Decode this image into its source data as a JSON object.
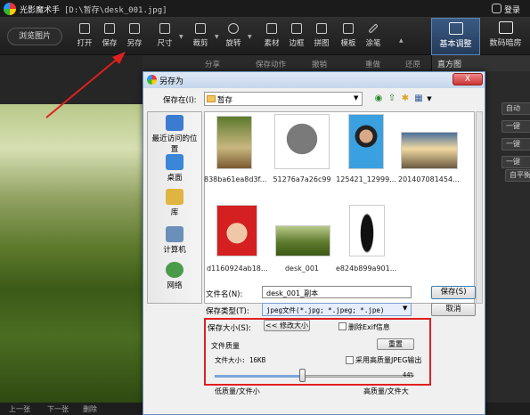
{
  "app": {
    "title": "光影魔术手",
    "path": "[D:\\暂存\\desk_001.jpg]",
    "login": "登录"
  },
  "toolbar": {
    "browse": "浏览图片",
    "tools": [
      "打开",
      "保存",
      "另存",
      "尺寸",
      "裁剪",
      "旋转",
      "素材",
      "边框",
      "拼图",
      "模板",
      "涂笔"
    ],
    "tabs": {
      "basic": "基本调整",
      "digital": "数码暗房"
    }
  },
  "subbar": {
    "share": "分享",
    "action": "保存动作",
    "undo": "撤销",
    "redo": "重做",
    "restore": "还原",
    "histogram": "直方图"
  },
  "right_buttons": [
    "自动",
    "一键",
    "一键",
    "一键",
    "自平衡"
  ],
  "bottom": [
    "上一张",
    "下一张",
    "删除"
  ],
  "dialog": {
    "title": "另存为",
    "close": "X",
    "save_in_label": "保存在(I):",
    "save_in_value": "暂存",
    "places": [
      "最近访问的位置",
      "桌面",
      "库",
      "计算机",
      "网络"
    ],
    "files": [
      "838ba61ea8d3f...",
      "51276a7a26c99",
      "125421_12999...",
      "201407081454...",
      "d1160924ab18...",
      "desk_001",
      "e824b899a901..."
    ],
    "file_name_label": "文件名(N):",
    "file_name_value": "desk_001_副本",
    "file_type_label": "保存类型(T):",
    "file_type_value": "jpeg文件(*.jpg; *.jpeg; *.jpe)",
    "save_button": "保存(S)",
    "cancel_button": "取消",
    "save_size_label": "保存大小(S):",
    "resize_button": "<< 修改大小",
    "exif_label": "删除Exif信息",
    "quality_label": "文件质量",
    "reset_button": "重置",
    "file_size_label": "文件大小: 16KB",
    "hq_label": "采用高质量JPEG输出",
    "quality_value": 44,
    "quality_text": "44%",
    "low_label": "低质量/文件小",
    "high_label": "高质量/文件大"
  }
}
